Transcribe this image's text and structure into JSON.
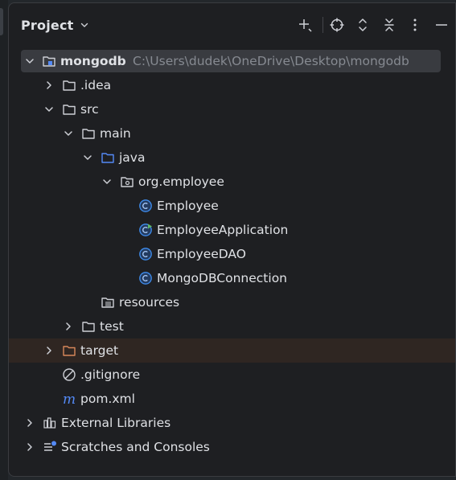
{
  "panel": {
    "title": "Project"
  },
  "toolbar": {
    "icons": [
      "add-icon",
      "locate-icon",
      "expand-all-icon",
      "collapse-all-icon",
      "more-icon",
      "minimize-icon"
    ]
  },
  "tree": {
    "root": {
      "label": "mongodb",
      "path": "C:\\Users\\dudek\\OneDrive\\Desktop\\mongodb"
    },
    "idea": "idea_label_placeholder",
    "items": {
      "idea": ".idea",
      "src": "src",
      "main": "main",
      "java": "java",
      "org_employee": "org.employee",
      "employee": "Employee",
      "employee_application": "EmployeeApplication",
      "employee_dao": "EmployeeDAO",
      "mongodb_connection": "MongoDBConnection",
      "resources": "resources",
      "test": "test",
      "target": "target",
      "gitignore": ".gitignore",
      "pom": "pom.xml",
      "external_libraries": "External Libraries",
      "scratches": "Scratches and Consoles"
    }
  },
  "colors": {
    "background": "#1e1f22",
    "text": "#dfe1e5",
    "path_text": "#868a91",
    "class_icon": "#3f8ef0",
    "folder_icon": "#ced0d6",
    "source_folder_icon": "#548af7",
    "excluded_folder": "#d7875a",
    "selection": "#393b40"
  }
}
